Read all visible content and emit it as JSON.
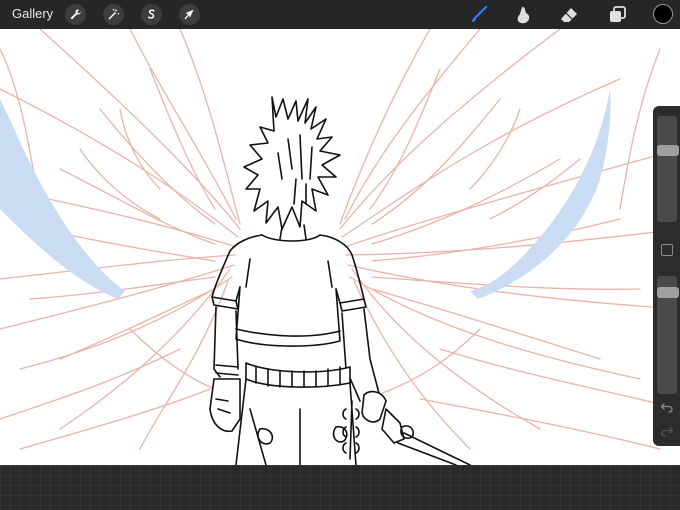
{
  "topbar": {
    "gallery_label": "Gallery",
    "left_tools": [
      {
        "name": "actions",
        "icon": "wrench-icon"
      },
      {
        "name": "adjustments",
        "icon": "magic-wand-icon"
      },
      {
        "name": "selection",
        "icon": "selection-s-icon"
      },
      {
        "name": "transform",
        "icon": "arrow-cursor-icon"
      }
    ],
    "right_tools": [
      {
        "name": "brush",
        "icon": "brush-icon",
        "active": true
      },
      {
        "name": "smudge",
        "icon": "smudge-icon",
        "active": false
      },
      {
        "name": "eraser",
        "icon": "eraser-icon",
        "active": false
      },
      {
        "name": "layers",
        "icon": "layers-icon",
        "active": false
      }
    ],
    "current_color": "#000000"
  },
  "colors": {
    "active_tool": "#2f7bff",
    "sketch_lines": "#e8b4a8",
    "ink_lines": "#111111",
    "wing_fill": "#c9dcf4"
  },
  "sidebar": {
    "brush_size_level": 0.3,
    "opacity_level": 0.1,
    "icons": [
      "undo-icon",
      "redo-icon"
    ]
  }
}
